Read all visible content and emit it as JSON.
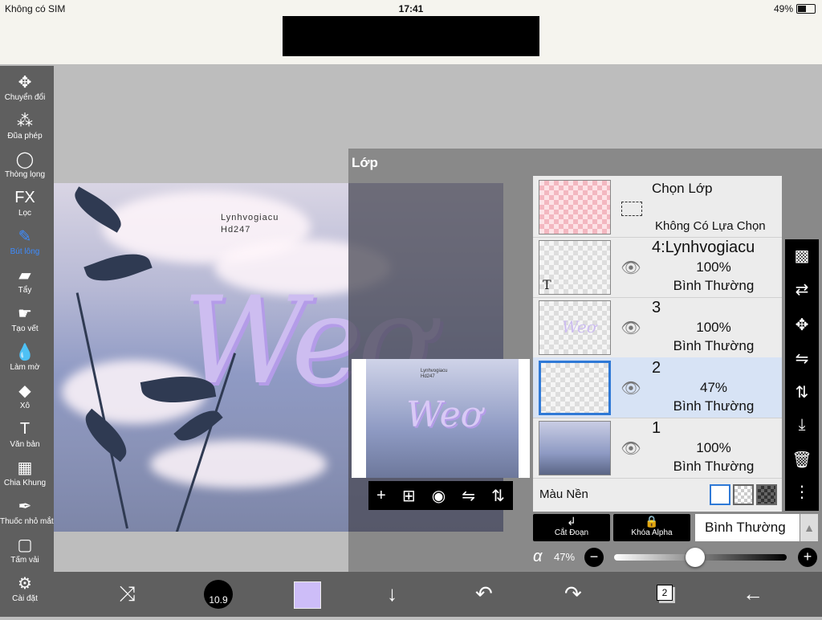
{
  "status_bar": {
    "carrier": "Không có SIM",
    "time": "17:41",
    "battery": "49%",
    "battery_level": 0.49
  },
  "toolbar": {
    "tools": [
      {
        "label": "Chuyển đổi",
        "icon": "move-icon",
        "glyph": "✥"
      },
      {
        "label": "Đũa phép",
        "icon": "magic-wand-icon",
        "glyph": "⁂"
      },
      {
        "label": "Thòng lọng",
        "icon": "lasso-icon",
        "glyph": "◯"
      },
      {
        "label": "Lọc",
        "icon": "filter-fx-icon",
        "glyph": "FX"
      },
      {
        "label": "Bút lông",
        "icon": "brush-icon",
        "glyph": "✎",
        "active": true
      },
      {
        "label": "Tẩy",
        "icon": "eraser-icon",
        "glyph": "▰"
      },
      {
        "label": "Tạo vết",
        "icon": "smudge-icon",
        "glyph": "☛"
      },
      {
        "label": "Làm mờ",
        "icon": "blur-drop-icon",
        "glyph": "💧"
      },
      {
        "label": "Xô",
        "icon": "bucket-icon",
        "glyph": "◆"
      },
      {
        "label": "Văn bản",
        "icon": "text-icon",
        "glyph": "T"
      },
      {
        "label": "Chia Khung",
        "icon": "frame-divider-icon",
        "glyph": "▦"
      },
      {
        "label": "Thuốc nhỏ mắt",
        "icon": "eyedropper-icon",
        "glyph": "✒"
      },
      {
        "label": "Tấm vải",
        "icon": "canvas-icon",
        "glyph": "▢"
      },
      {
        "label": "Cài đặt",
        "icon": "gear-icon",
        "glyph": "⚙"
      }
    ]
  },
  "canvas": {
    "watermark_line1": "Lynhvogiacu",
    "watermark_line2": "Hd247",
    "art_text": "Weơ"
  },
  "layer_panel": {
    "title": "Lớp",
    "select_layer": {
      "title": "Chọn Lớp",
      "subtitle": "Không Có Lựa Chọn"
    },
    "layers": [
      {
        "name": "4:Lynhvogiacu",
        "opacity": "100%",
        "mode": "Bình Thường",
        "thumb": "text"
      },
      {
        "name": "3",
        "opacity": "100%",
        "mode": "Bình Thường",
        "thumb": "art"
      },
      {
        "name": "2",
        "opacity": "47%",
        "mode": "Bình Thường",
        "thumb": "selected"
      },
      {
        "name": "1",
        "opacity": "100%",
        "mode": "Bình Thường",
        "thumb": "photo"
      }
    ],
    "background_label": "Màu Nền",
    "clip_label": "Cắt Đoạn",
    "alpha_lock_label": "Khóa Alpha",
    "blend_mode": "Bình Thường",
    "alpha_symbol": "α",
    "alpha_value": "47%",
    "alpha_fraction": 0.47,
    "thumb_text_glyph": "T",
    "preview_art_text": "Weơ",
    "preview_watermark": "Lynhvogiacu\nHd247"
  },
  "bottom_bar": {
    "brush_size": "10.9",
    "layer_count": "2"
  },
  "colors": {
    "current_color": "#cdbdf8",
    "accent": "#2f79d6"
  }
}
